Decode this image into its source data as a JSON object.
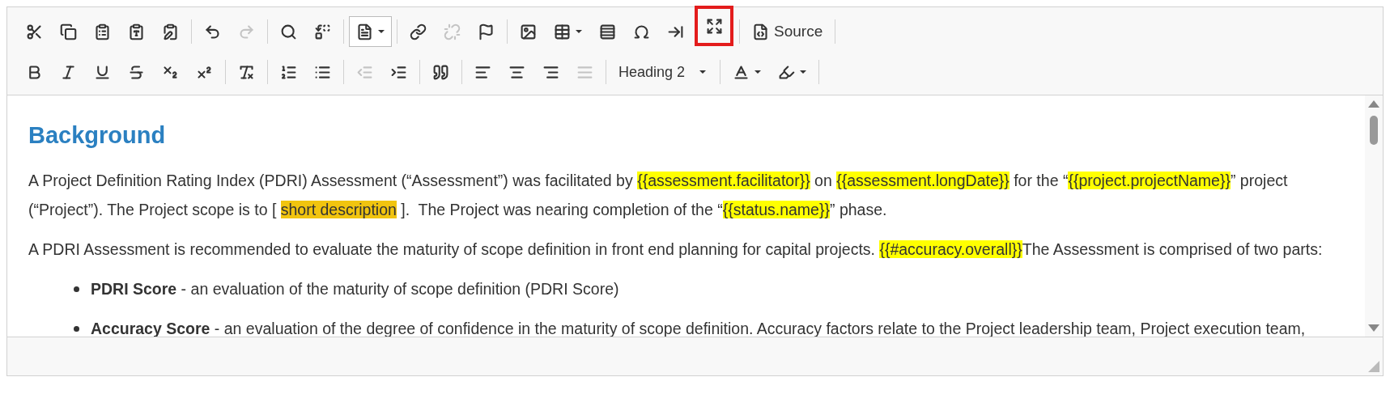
{
  "toolbar": {
    "rows": [
      [
        [
          {
            "kind": "cut",
            "disabled": false,
            "on": false,
            "outlined": false
          },
          {
            "kind": "copy",
            "disabled": false,
            "on": false,
            "outlined": false
          },
          {
            "kind": "paste",
            "disabled": false,
            "on": false,
            "outlined": false
          },
          {
            "kind": "paste-text",
            "disabled": false,
            "on": false,
            "outlined": false
          },
          {
            "kind": "paste-word",
            "disabled": false,
            "on": false,
            "outlined": false
          }
        ],
        [
          {
            "kind": "undo",
            "disabled": false,
            "on": false,
            "outlined": false
          },
          {
            "kind": "redo",
            "disabled": true,
            "on": false,
            "outlined": false
          }
        ],
        [
          {
            "kind": "find",
            "disabled": false,
            "on": false,
            "outlined": false
          },
          {
            "kind": "replace",
            "disabled": false,
            "on": false,
            "outlined": false
          }
        ],
        [
          {
            "kind": "templates",
            "disabled": false,
            "on": true,
            "outlined": false
          }
        ],
        [
          {
            "kind": "link",
            "disabled": false,
            "on": false,
            "outlined": false
          },
          {
            "kind": "unlink",
            "disabled": true,
            "on": false,
            "outlined": false
          },
          {
            "kind": "anchor",
            "disabled": false,
            "on": false,
            "outlined": false
          }
        ],
        [
          {
            "kind": "image",
            "disabled": false,
            "on": false,
            "outlined": false
          },
          {
            "kind": "table",
            "disabled": false,
            "on": false,
            "outlined": false
          },
          {
            "kind": "rule",
            "disabled": false,
            "on": false,
            "outlined": false
          },
          {
            "kind": "special-char",
            "disabled": false,
            "on": false,
            "outlined": false
          },
          {
            "kind": "page-break",
            "disabled": false,
            "on": false,
            "outlined": false
          },
          {
            "kind": "maximize",
            "disabled": false,
            "on": false,
            "outlined": true
          }
        ],
        [
          {
            "kind": "source",
            "label": "Source",
            "disabled": false,
            "on": false,
            "outlined": false
          }
        ]
      ],
      [
        [
          {
            "kind": "bold",
            "disabled": false,
            "on": false,
            "outlined": false
          },
          {
            "kind": "italic",
            "disabled": false,
            "on": false,
            "outlined": false
          },
          {
            "kind": "underline",
            "disabled": false,
            "on": false,
            "outlined": false
          },
          {
            "kind": "strike",
            "disabled": false,
            "on": false,
            "outlined": false
          },
          {
            "kind": "subscript",
            "disabled": false,
            "on": false,
            "outlined": false
          },
          {
            "kind": "superscript",
            "disabled": false,
            "on": false,
            "outlined": false
          }
        ],
        [
          {
            "kind": "remove-format",
            "disabled": false,
            "on": false,
            "outlined": false
          }
        ],
        [
          {
            "kind": "numbered-list",
            "disabled": false,
            "on": false,
            "outlined": false
          },
          {
            "kind": "bulleted-list",
            "disabled": false,
            "on": false,
            "outlined": false
          }
        ],
        [
          {
            "kind": "outdent",
            "disabled": true,
            "on": false,
            "outlined": false
          },
          {
            "kind": "indent",
            "disabled": false,
            "on": false,
            "outlined": false
          }
        ],
        [
          {
            "kind": "blockquote",
            "disabled": false,
            "on": false,
            "outlined": false
          }
        ],
        [
          {
            "kind": "align-left",
            "disabled": false,
            "on": false,
            "outlined": false
          },
          {
            "kind": "align-center",
            "disabled": false,
            "on": false,
            "outlined": false
          },
          {
            "kind": "align-right",
            "disabled": false,
            "on": false,
            "outlined": false
          },
          {
            "kind": "justify",
            "disabled": true,
            "on": false,
            "outlined": false
          }
        ],
        [
          {
            "kind": "format",
            "value": "Heading 2",
            "disabled": false,
            "on": false,
            "outlined": false
          }
        ],
        [
          {
            "kind": "text-color",
            "disabled": false,
            "on": false,
            "outlined": false
          },
          {
            "kind": "background-color",
            "disabled": false,
            "on": false,
            "outlined": false
          }
        ]
      ]
    ]
  },
  "content": [
    {
      "kind": "heading",
      "text": "Background"
    },
    {
      "kind": "paragraph",
      "segments": [
        {
          "text": "A Project Definition Rating Index (PDRI) Assessment (“Assessment”) was facilitated by "
        },
        {
          "text": "{{assessment.facilitator}}",
          "color": "#ffff00"
        },
        {
          "text": " on "
        },
        {
          "text": "{{assessment.longDate}}",
          "color": "#ffff00"
        },
        {
          "text": " for the “"
        },
        {
          "text": "{{project.projectName}}",
          "color": "#ffff00"
        },
        {
          "text": "” project\n(“Project”). The Project scope is to [ "
        },
        {
          "text": "short description",
          "color": "#f1c40f"
        },
        {
          "text": " ].  The Project was nearing completion of the “"
        },
        {
          "text": "{{status.name}}",
          "color": "#ffff00"
        },
        {
          "text": "” phase."
        }
      ]
    },
    {
      "kind": "paragraph",
      "segments": [
        {
          "text": "A PDRI Assessment is recommended to evaluate the maturity of scope definition in front end planning for capital projects. "
        },
        {
          "text": "{{#accuracy.overall}}",
          "color": "#ffff00"
        },
        {
          "text": "The Assessment is comprised of two parts:"
        }
      ]
    },
    {
      "kind": "list",
      "items": [
        "**PDRI Score** - an evaluation of the maturity of scope definition (PDRI Score)",
        "**Accuracy Score** - an evaluation of the degree of confidence in the maturity of scope definition. Accuracy factors relate to the Project leadership team, Project execution team,"
      ]
    }
  ]
}
